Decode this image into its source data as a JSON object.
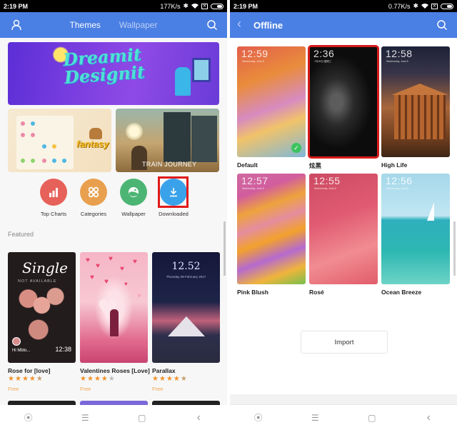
{
  "left_screen": {
    "status_bar": {
      "time": "2:19 PM",
      "network_speed": "177K/s"
    },
    "app_bar": {
      "tabs": [
        {
          "label": "Themes",
          "active": true
        },
        {
          "label": "Wallpaper",
          "active": false
        }
      ],
      "left_icon": "user-icon",
      "right_icon": "search-icon"
    },
    "banner": {
      "text_line1": "Dreamit",
      "text_line2": "Designit"
    },
    "promo_cards": [
      {
        "label": "fantasy"
      },
      {
        "label": "TRAIN JOURNEY"
      }
    ],
    "quick_actions": [
      {
        "label": "Top Charts",
        "icon": "bar-chart-icon",
        "color": "#e6615a"
      },
      {
        "label": "Categories",
        "icon": "grid-circles-icon",
        "color": "#e8a04f"
      },
      {
        "label": "Wallpaper",
        "icon": "image-icon",
        "color": "#4db574"
      },
      {
        "label": "Downloaded",
        "icon": "download-icon",
        "color": "#3aa2ea",
        "highlighted": true
      }
    ],
    "section_title": "Featured",
    "featured": [
      {
        "name": "Rose for [love]",
        "rating": 4.5,
        "price": "Free",
        "thumb_text": "Single",
        "thumb_subtext": "NOT AVAILABLE",
        "thumb_greeting": "Hi Mblo...",
        "thumb_time": "12:38"
      },
      {
        "name": "Valentines Roses [Love]",
        "rating": 4,
        "price": "Free"
      },
      {
        "name": "Parallax",
        "rating": 4.5,
        "price": "Free",
        "thumb_time": "12.52",
        "thumb_date": "Thursday 09 February 2017"
      }
    ]
  },
  "right_screen": {
    "status_bar": {
      "time": "2:19 PM",
      "network_speed": "0.77K/s"
    },
    "app_bar": {
      "title": "Offline",
      "back_icon": "back-chevron-icon",
      "right_icon": "search-icon"
    },
    "themes": [
      {
        "name": "Default",
        "time": "12:59",
        "date": "Wednesday, June 8",
        "applied": true
      },
      {
        "name": "炫黑",
        "time": "2:36",
        "date": "7月28日 星期三",
        "selected": true
      },
      {
        "name": "High Life",
        "time": "12:58",
        "date": "Wednesday, June 8"
      },
      {
        "name": "Pink Blush",
        "time": "12:57",
        "date": "Wednesday, June 8"
      },
      {
        "name": "Rosé",
        "time": "12:55",
        "date": "Wednesday, June 8"
      },
      {
        "name": "Ocean Breeze",
        "time": "12:56",
        "date": "Wednesday, June 8"
      }
    ],
    "import_button": "Import"
  },
  "nav_bar": {
    "buttons": [
      "assist",
      "menu",
      "home",
      "back"
    ]
  },
  "glyphs": {
    "star": "★",
    "check": "✓",
    "back": "‹",
    "menu": "☰",
    "home": "▢",
    "assist": "⦿",
    "bluetooth": "✱",
    "wifi": "◠",
    "sim": "✕"
  }
}
